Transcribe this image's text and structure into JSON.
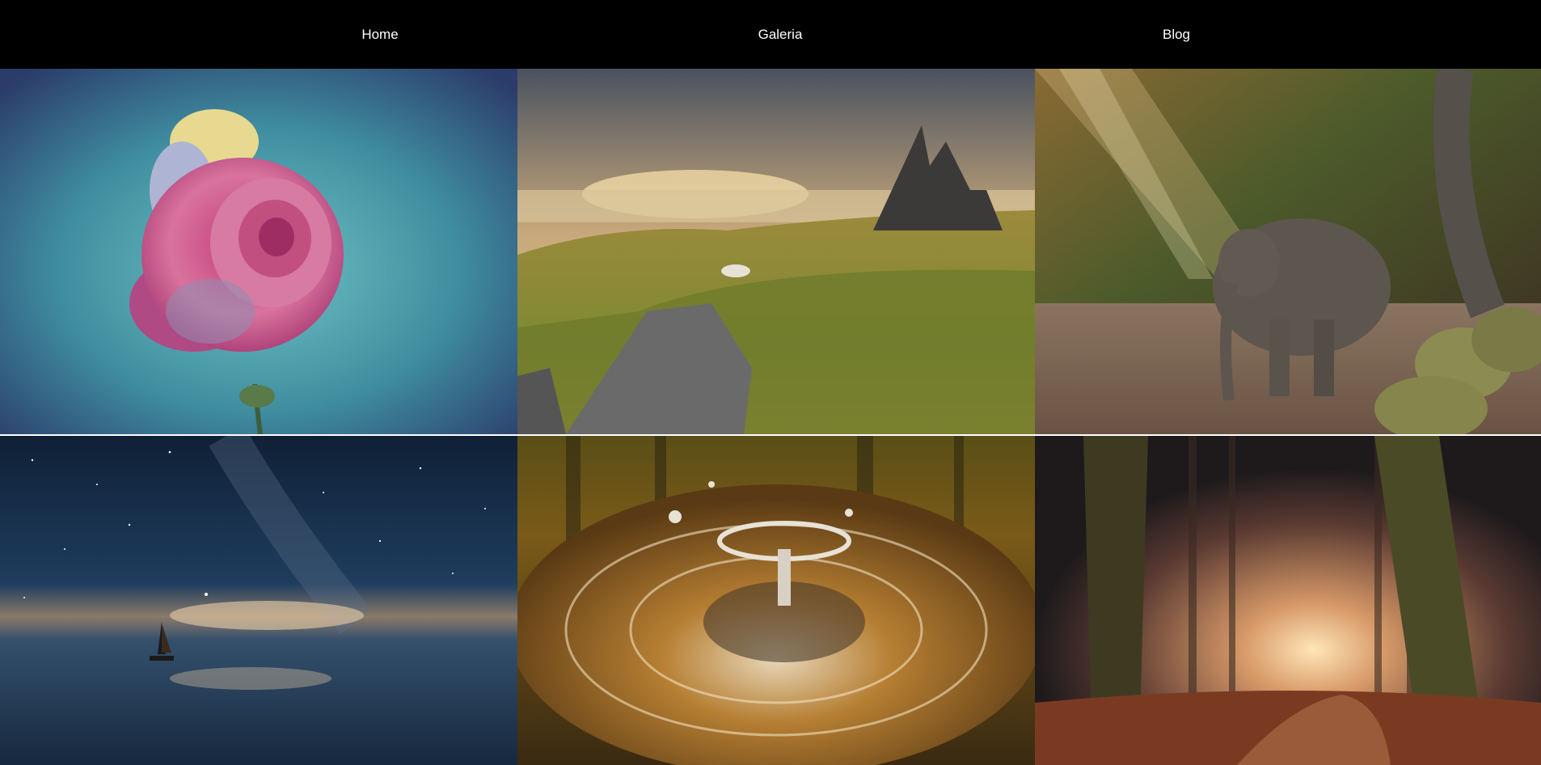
{
  "nav": {
    "home": "Home",
    "galeria": "Galeria",
    "blog": "Blog"
  },
  "gallery": {
    "images": [
      {
        "subject": "rose-photo"
      },
      {
        "subject": "mountain-landscape-photo"
      },
      {
        "subject": "baby-elephant-photo"
      },
      {
        "subject": "night-sky-sailboat-photo"
      },
      {
        "subject": "water-drop-splash-photo"
      },
      {
        "subject": "autumn-forest-path-photo"
      }
    ]
  }
}
